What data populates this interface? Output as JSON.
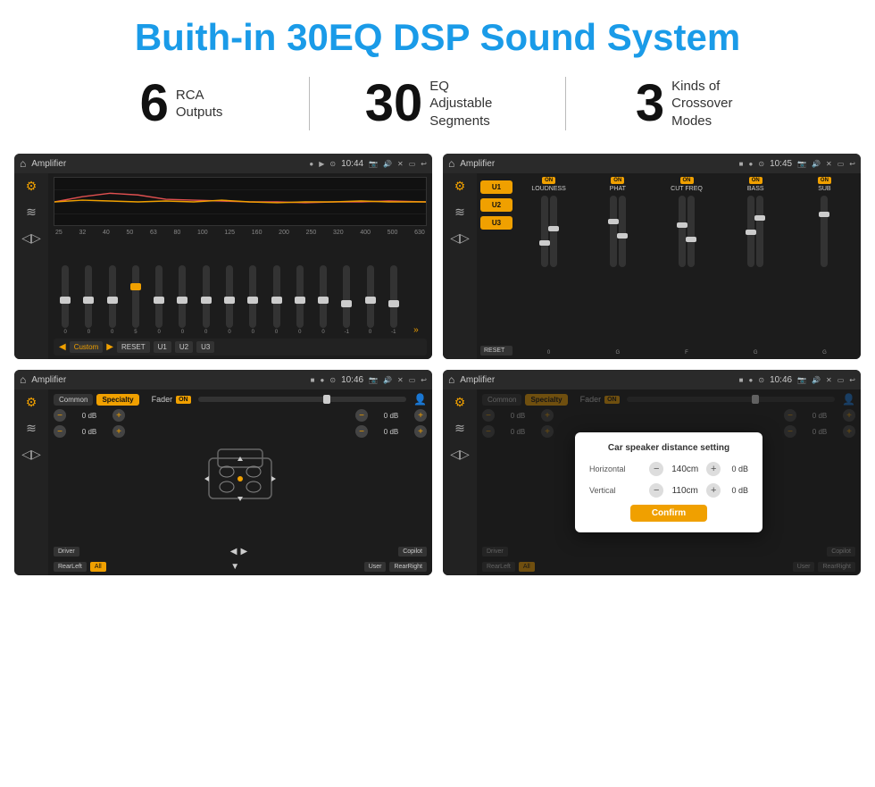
{
  "header": {
    "title": "Buith-in 30EQ DSP Sound System"
  },
  "stats": [
    {
      "number": "6",
      "label": "RCA\nOutputs"
    },
    {
      "number": "30",
      "label": "EQ Adjustable\nSegments"
    },
    {
      "number": "3",
      "label": "Kinds of\nCrossover Modes"
    }
  ],
  "screens": [
    {
      "id": "screen1",
      "statusTitle": "Amplifier",
      "statusTime": "10:44",
      "type": "eq"
    },
    {
      "id": "screen2",
      "statusTitle": "Amplifier",
      "statusTime": "10:45",
      "type": "crossover"
    },
    {
      "id": "screen3",
      "statusTitle": "Amplifier",
      "statusTime": "10:46",
      "type": "fader"
    },
    {
      "id": "screen4",
      "statusTitle": "Amplifier",
      "statusTime": "10:46",
      "type": "fader-dialog"
    }
  ],
  "eq": {
    "frequencies": [
      "25",
      "32",
      "40",
      "50",
      "63",
      "80",
      "100",
      "125",
      "160",
      "200",
      "250",
      "320",
      "400",
      "500",
      "630"
    ],
    "values": [
      "0",
      "0",
      "0",
      "5",
      "0",
      "0",
      "0",
      "0",
      "0",
      "0",
      "0",
      "0",
      "-1",
      "0",
      "-1"
    ],
    "presets": [
      "Custom",
      "RESET",
      "U1",
      "U2",
      "U3"
    ]
  },
  "crossover": {
    "channels": [
      "LOUDNESS",
      "PHAT",
      "CUT FREQ",
      "BASS",
      "SUB"
    ],
    "uButtons": [
      "U1",
      "U2",
      "U3"
    ],
    "resetLabel": "RESET"
  },
  "fader": {
    "modes": [
      "Common",
      "Specialty"
    ],
    "faderLabel": "Fader",
    "onLabel": "ON",
    "volumes": [
      "0 dB",
      "0 dB",
      "0 dB",
      "0 dB"
    ],
    "buttons": {
      "driver": "Driver",
      "copilot": "Copilot",
      "rearLeft": "RearLeft",
      "all": "All",
      "user": "User",
      "rearRight": "RearRight"
    }
  },
  "dialog": {
    "title": "Car speaker distance setting",
    "horizontal": {
      "label": "Horizontal",
      "value": "140cm"
    },
    "vertical": {
      "label": "Vertical",
      "value": "110cm"
    },
    "rightValues": [
      "0 dB",
      "0 dB"
    ],
    "confirmLabel": "Confirm"
  }
}
